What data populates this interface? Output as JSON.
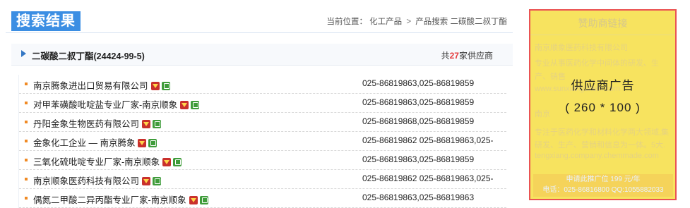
{
  "header": {
    "title": "搜索结果",
    "breadcrumb": {
      "prefix": "当前位置：",
      "items": [
        "化工产品",
        "产品搜索",
        "二碳酸二叔丁酯"
      ],
      "separator": ">"
    }
  },
  "product": {
    "name": "二碳酸二叔丁酯(24424-99-5)",
    "count_prefix": "共",
    "count": "27",
    "count_suffix": "家供应商"
  },
  "suppliers": [
    {
      "company": "南京腾象进出口贸易有限公司",
      "phone": "025-86819863,025-86819859"
    },
    {
      "company": "对甲苯磺酸吡啶盐专业厂家-南京顺象",
      "phone": "025-86819863,025-86819859"
    },
    {
      "company": "丹阳金象生物医药有限公司",
      "phone": "025-86819868,025-86819859"
    },
    {
      "company": "金象化工企业 — 南京腾象",
      "phone": "025-86819862 025-86819863,025-"
    },
    {
      "company": "三氧化硫吡啶专业厂家-南京顺象",
      "phone": "025-86819863,025-86819859"
    },
    {
      "company": "南京顺象医药科技有限公司",
      "phone": "025-86819862 025-86819863,025-"
    },
    {
      "company": "偶氮二甲酸二异丙酯专业厂家-南京顺象",
      "phone": "025-86819863,025-86819863"
    }
  ],
  "ad": {
    "heading": "赞助商链接",
    "bg_lines": [
      "南京顺象医药科技有限公司",
      "专业从事医药化学中间体的研发、生",
      "产、销售",
      "www.sunxiangchem.com",
      "南京",
      "专注于医药化学和材料化学两大领域,集",
      "研发、生产、营销和信息为一体。5大.",
      "tengxiang.company.chemmade.com"
    ],
    "label": "供应商广告",
    "size": "( 260 * 100 )",
    "price_line1": "申请此推广位 199 元/年",
    "price_line2": "电话：025-86816800  QQ:1055882033",
    "colors": {
      "background": "#f7e35f",
      "border": "#ea5353"
    }
  }
}
